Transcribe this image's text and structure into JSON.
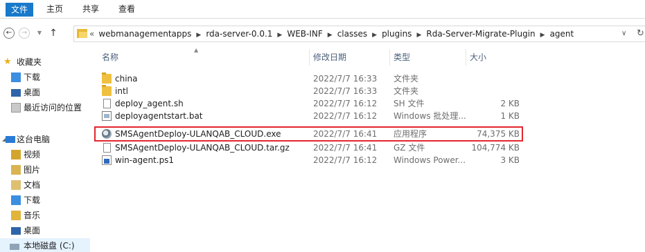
{
  "ribbon": {
    "tabs": [
      "文件",
      "主页",
      "共享",
      "查看"
    ]
  },
  "address": {
    "overflow": "«",
    "crumbs": [
      "webmanagementapps",
      "rda-server-0.0.1",
      "WEB-INF",
      "classes",
      "plugins",
      "Rda-Server-Migrate-Plugin",
      "agent"
    ]
  },
  "nav": {
    "favorites": "收藏夹",
    "fav_items": [
      "下载",
      "桌面",
      "最近访问的位置"
    ],
    "this_pc": "这台电脑",
    "pc_items": [
      "视频",
      "图片",
      "文档",
      "下载",
      "音乐",
      "桌面",
      "本地磁盘 (C:)"
    ]
  },
  "columns": {
    "name": "名称",
    "date": "修改日期",
    "type": "类型",
    "size": "大小"
  },
  "files": [
    {
      "name": "china",
      "date": "2022/7/7 16:33",
      "type": "文件夹",
      "size": "",
      "icon": "folder-icon"
    },
    {
      "name": "intl",
      "date": "2022/7/7 16:33",
      "type": "文件夹",
      "size": "",
      "icon": "folder-icon"
    },
    {
      "name": "deploy_agent.sh",
      "date": "2022/7/7 16:12",
      "type": "SH 文件",
      "size": "2 KB",
      "icon": "file-icon"
    },
    {
      "name": "deployagentstart.bat",
      "date": "2022/7/7 16:12",
      "type": "Windows 批处理...",
      "size": "1 KB",
      "icon": "batch-file-icon"
    },
    {
      "name": "SMSAgentDeploy-ULANQAB_CLOUD.exe",
      "date": "2022/7/7 16:41",
      "type": "应用程序",
      "size": "74,375 KB",
      "icon": "exe-icon"
    },
    {
      "name": "SMSAgentDeploy-ULANQAB_CLOUD.tar.gz",
      "date": "2022/7/7 16:41",
      "type": "GZ 文件",
      "size": "104,774 KB",
      "icon": "file-icon"
    },
    {
      "name": "win-agent.ps1",
      "date": "2022/7/7 16:12",
      "type": "Windows Power...",
      "size": "3 KB",
      "icon": "powershell-icon"
    }
  ],
  "colors": {
    "ribbon_file_tab": "#1979ca",
    "highlight_border": "#e2262e",
    "header_text": "#4c607a",
    "selected_nav": "#e5f3ff"
  }
}
